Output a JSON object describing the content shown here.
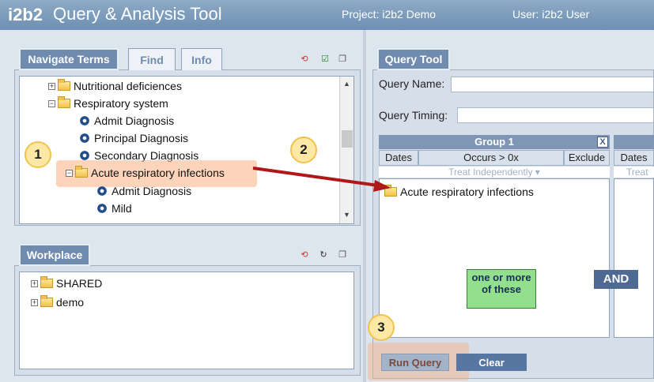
{
  "header": {
    "logo": "i2b2",
    "title": "Query & Analysis Tool",
    "project": "Project: i2b2 Demo",
    "user": "User: i2b2 User"
  },
  "navigate": {
    "tabs": [
      "Navigate Terms",
      "Find",
      "Info"
    ],
    "active_tab": "Navigate Terms",
    "tree": [
      {
        "label": "Nutritional deficiences",
        "type": "folder",
        "expander": "+"
      },
      {
        "label": "Respiratory system",
        "type": "folder",
        "expander": "-"
      },
      {
        "label": "Admit Diagnosis",
        "type": "leaf"
      },
      {
        "label": "Principal Diagnosis",
        "type": "leaf"
      },
      {
        "label": "Secondary Diagnosis",
        "type": "leaf"
      },
      {
        "label": "Acute respiratory infections",
        "type": "folder",
        "expander": "-",
        "highlighted": true
      },
      {
        "label": "Admit Diagnosis",
        "type": "leaf"
      },
      {
        "label": "Mild",
        "type": "leaf"
      }
    ]
  },
  "workplace": {
    "tab": "Workplace",
    "tree": [
      {
        "label": "SHARED",
        "type": "folder",
        "expander": "+"
      },
      {
        "label": "demo",
        "type": "folder",
        "expander": "+"
      }
    ]
  },
  "query_tool": {
    "tab": "Query Tool",
    "query_name_label": "Query Name:",
    "query_timing_label": "Query Timing:",
    "group1": {
      "title": "Group 1",
      "close": "X",
      "dates": "Dates",
      "occurs": "Occurs > 0x",
      "exclude": "Exclude",
      "timing": "Treat Independently",
      "item": "Acute respiratory infections"
    },
    "group2": {
      "dates": "Dates",
      "timing": "Treat"
    },
    "callout": "one or more of these",
    "and_label": "AND",
    "run_button": "Run Query",
    "clear_button": "Clear"
  },
  "annotations": {
    "step1": "1",
    "step2": "2",
    "step3": "3",
    "arrow_color": "#b01818",
    "badge_color": "#fde8a6"
  }
}
